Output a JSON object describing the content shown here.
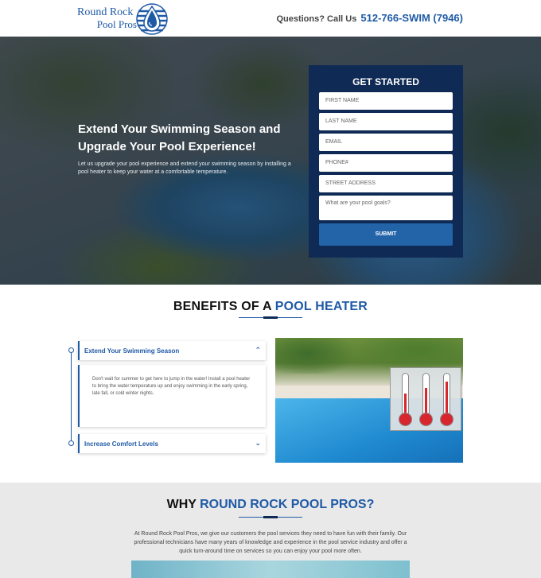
{
  "header": {
    "logo_line1": "Round Rock",
    "logo_line2": "Pool Pros",
    "phone_prompt": "Questions? Call Us",
    "phone_number": "512-766-SWIM (7946)"
  },
  "hero": {
    "title": "Extend Your Swimming Season and Upgrade Your Pool Experience!",
    "subtitle": "Let us upgrade your pool experience and extend your swimming season by installing a pool heater to keep your water at a comfortable temperature."
  },
  "form": {
    "title": "GET STARTED",
    "fields": {
      "first_name": "FIRST NAME",
      "last_name": "LAST NAME",
      "email": "EMAIL",
      "phone": "PHONE#",
      "address": "STREET ADDRESS",
      "goals": "What are your pool goals?"
    },
    "submit_label": "SUBMIT"
  },
  "benefits": {
    "title_prefix": "BENEFITS OF A ",
    "title_accent": "POOL HEATER",
    "items": [
      {
        "label": "Extend Your Swimming Season",
        "expanded": true,
        "body": "Don't wait for summer to get here to jump in the water! Install a pool heater to bring the water temperature up and enjoy swimming in the early spring, late fall, or cold winter nights."
      },
      {
        "label": "Increase Comfort Levels",
        "expanded": false
      }
    ],
    "thermometer_levels": [
      0.55,
      0.7,
      0.85
    ]
  },
  "why": {
    "title_prefix": "WHY ",
    "title_accent": "ROUND ROCK POOL PROS?",
    "text": "At Round Rock Pool Pros, we give our customers the pool services they need to have fun with their family. Our professional technicians have many years of knowledge and experience in the pool service industry and offer a quick turn-around time on services so you can enjoy your pool more often."
  },
  "colors": {
    "brand_blue": "#1f5aa6",
    "form_bg": "#0f2a55",
    "submit_bg": "#2363a8"
  }
}
